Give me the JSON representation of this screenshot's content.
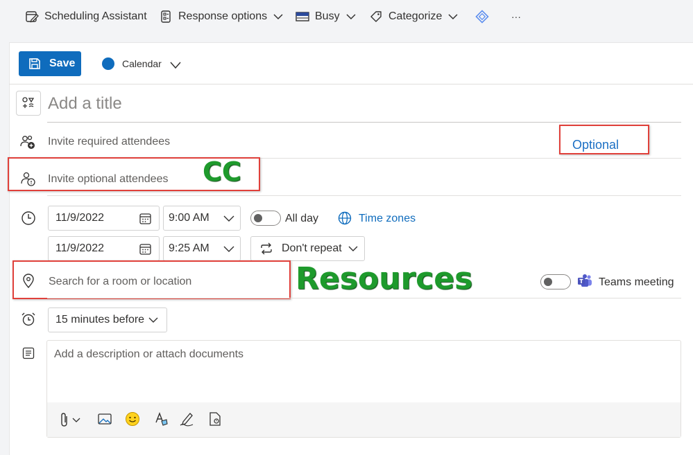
{
  "toolbar": {
    "scheduling_assistant": "Scheduling Assistant",
    "response_options": "Response options",
    "busy": "Busy",
    "categorize": "Categorize",
    "more": "···"
  },
  "actions": {
    "save_label": "Save",
    "calendar_label": "Calendar",
    "calendar_color": "#0f6cbd"
  },
  "event": {
    "title_placeholder": "Add a title",
    "required_placeholder": "Invite required attendees",
    "optional_link": "Optional",
    "optional_placeholder": "Invite optional attendees",
    "start_date": "11/9/2022",
    "start_time": "9:00 AM",
    "all_day_label": "All day",
    "time_zones_label": "Time zones",
    "end_date": "11/9/2022",
    "end_time": "9:25 AM",
    "repeat_label": "Don't repeat",
    "location_placeholder": "Search for a room or location",
    "teams_label": "Teams meeting",
    "reminder_label": "15 minutes before",
    "description_placeholder": "Add a description or attach documents"
  },
  "annotations": {
    "cc": "CC",
    "resources": "Resources"
  }
}
